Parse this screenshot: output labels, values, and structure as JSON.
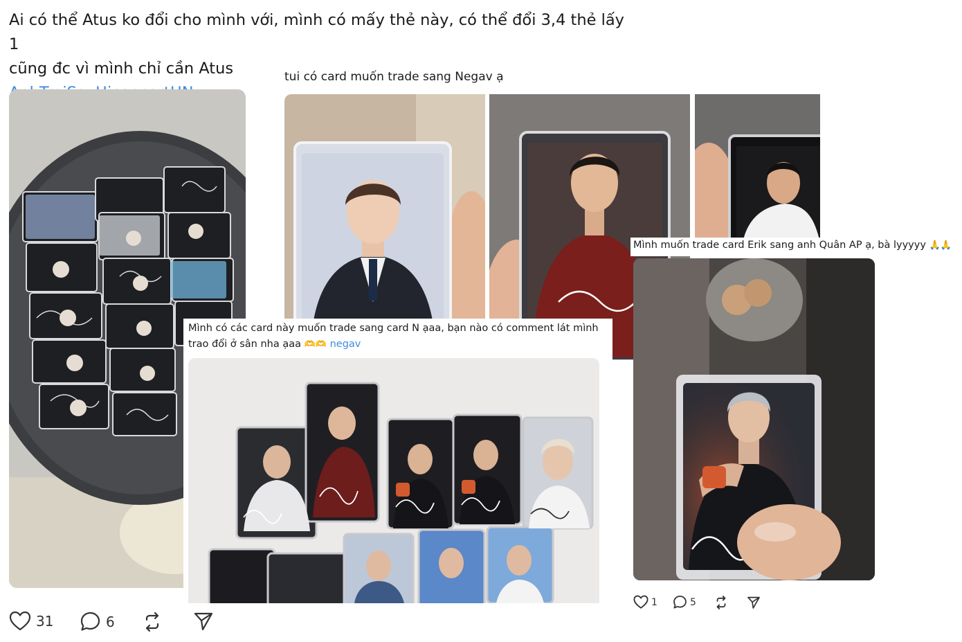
{
  "main_post": {
    "text_line1": "Ai có thể Atus ko đổi cho mình với, mình có mấy thẻ này, có thể đổi 3,4 thẻ lấy 1",
    "text_line2": "cũng đc vì mình chỉ cần Atus",
    "hashtag": "AnhTraiSayHiconcertHN",
    "likes": "31",
    "comments": "6"
  },
  "post_negav_trade": {
    "text": "tui có card muốn trade sang Negav ạ"
  },
  "post_erik_trade": {
    "text": "Mình muốn trade card Erik sang anh Quân AP ạ, bà lyyyyy",
    "emoji": "🙏🙏",
    "likes": "1",
    "comments": "5"
  },
  "post_card_n": {
    "text_line1": "Mình có các card này muốn trade sang card N ạaa, bạn nào có comment lát mình",
    "text_line2": "trao đổi ở sân nha ạaa",
    "emoji": "🫶🫶",
    "hashtag": "negav"
  },
  "colors": {
    "link": "#3d8de0",
    "text": "#1c1c1c",
    "icon": "#333333"
  }
}
